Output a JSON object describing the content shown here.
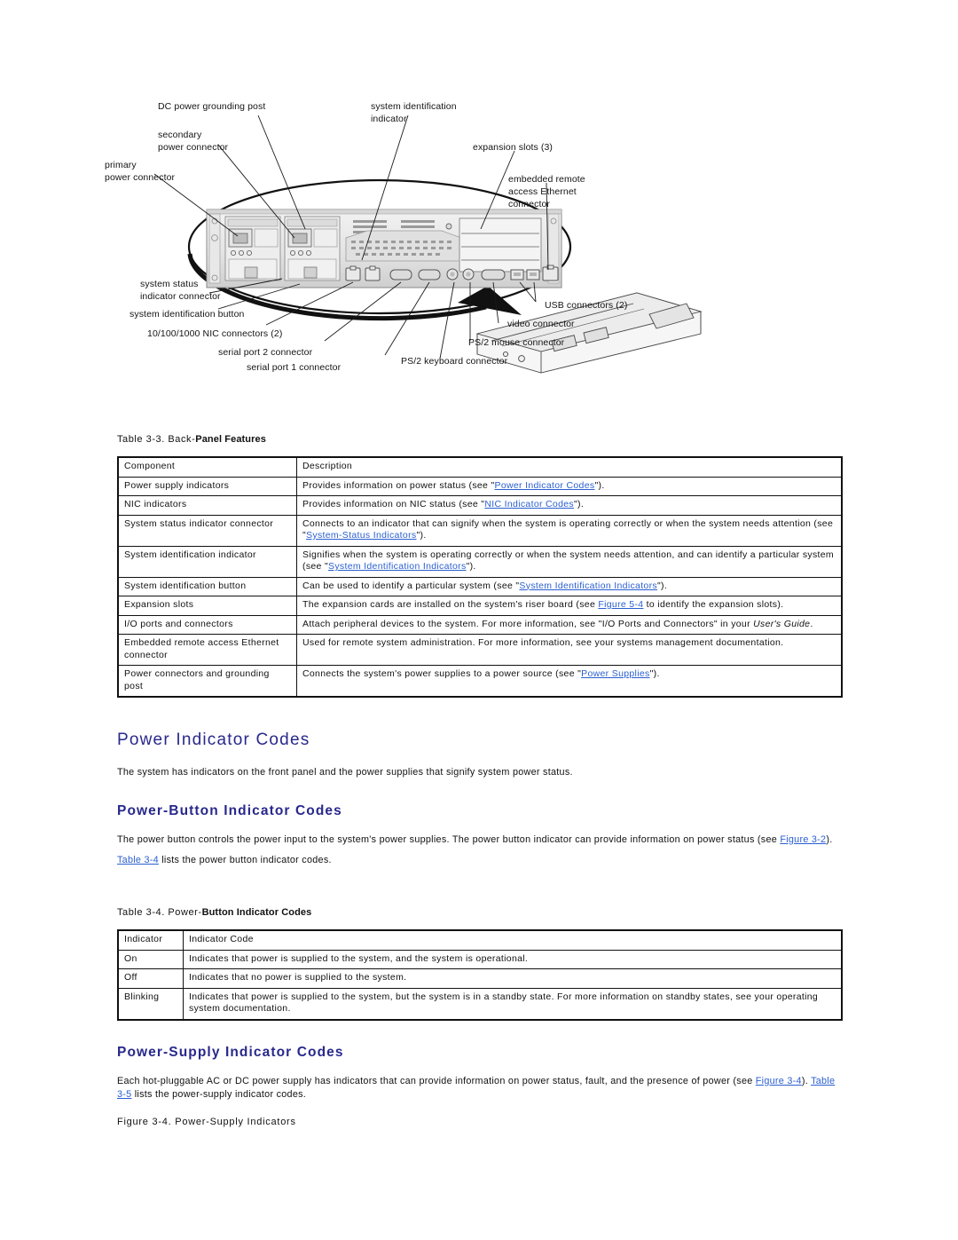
{
  "figure": {
    "name": "back-panel-features-diagram",
    "callouts_top_left": [
      "DC power grounding post",
      "secondary",
      "power connector",
      "primary",
      "power connector"
    ],
    "callout_dc_power_grounding_post": "DC power grounding post",
    "callout_secondary_power_connector_l1": "secondary",
    "callout_secondary_power_connector_l2": "power connector",
    "callout_primary_power_connector_l1": "primary",
    "callout_primary_power_connector_l2": "power connector",
    "callout_system_identification_indicator_l1": "system identification",
    "callout_system_identification_indicator_l2": "indicator",
    "callout_expansion_slots": "expansion slots (3)",
    "callout_embedded_remote_l1": "embedded remote",
    "callout_embedded_remote_l2": "access Ethernet",
    "callout_embedded_remote_l3": "connector",
    "callout_system_status_l1": "system status",
    "callout_system_status_l2": "indicator connector",
    "callout_system_identification_button": "system identification button",
    "callout_nic_connectors": "10/100/1000 NIC connectors (2)",
    "callout_serial_port_2": "serial port 2 connector",
    "callout_serial_port_1": "serial port 1 connector",
    "callout_usb_connectors": "USB connectors (2)",
    "callout_video_connector": "video connector",
    "callout_ps2_mouse": "PS/2 mouse connector",
    "callout_ps2_keyboard": "PS/2 keyboard connector"
  },
  "table33": {
    "caption_plain": "Table 3-3. Back-",
    "caption_bold": "Panel Features",
    "headers": [
      "Component",
      "Description"
    ],
    "rows": [
      {
        "component": "Power supply indicators",
        "desc_pre": "Provides information on power status (see \"",
        "desc_link": "Power Indicator Codes",
        "desc_post": "\")."
      },
      {
        "component": "NIC indicators",
        "desc_pre": "Provides information on NIC status (see \"",
        "desc_link": "NIC Indicator Codes",
        "desc_post": "\")."
      },
      {
        "component": "System status indicator connector",
        "desc_pre": "Connects to an indicator that can signify when the system is operating correctly or when the system needs attention (see \"",
        "desc_link": "System-Status Indicators",
        "desc_post": "\")."
      },
      {
        "component": "System identification indicator",
        "desc_pre": "Signifies when the system is operating correctly or when the system needs attention, and can identify a particular system (see \"",
        "desc_link": "System Identification Indicators",
        "desc_post": "\")."
      },
      {
        "component": "System identification button",
        "desc_pre": "Can be used to identify a particular system (see \"",
        "desc_link": "System Identification Indicators",
        "desc_post": "\")."
      },
      {
        "component": "Expansion slots",
        "desc_pre": "The expansion cards are installed on the system's riser board (see ",
        "desc_link": "Figure 5-4",
        "desc_post": " to identify the expansion slots)."
      },
      {
        "component": "I/O ports and connectors",
        "desc_pre": "Attach peripheral devices to the system. For more information, see \"I/O Ports and Connectors\" in your ",
        "desc_italic": "User's Guide",
        "desc_post": "."
      },
      {
        "component": "Embedded remote access Ethernet connector",
        "desc_pre": "Used for remote system administration. For more information, see your systems management documentation.",
        "desc_link": "",
        "desc_post": ""
      },
      {
        "component": "Power connectors and grounding post",
        "desc_pre": "Connects the system's power supplies to a power source (see \"",
        "desc_link": "Power Supplies",
        "desc_post": "\")."
      }
    ]
  },
  "section_power_indicator_codes": {
    "heading": "Power Indicator Codes",
    "intro": "The system has indicators on the front panel and the power supplies that signify system power status."
  },
  "section_power_button": {
    "heading": "Power-Button Indicator Codes",
    "para1_pre": "The power button controls the power input to the system's power supplies. The power button indicator can provide information on power status (see ",
    "para1_link": "Figure 3-2",
    "para1_post": ").",
    "para2_link": "Table 3-4",
    "para2_post": " lists the power button indicator codes."
  },
  "table34": {
    "caption_plain": "Table 3-4. Power-",
    "caption_bold": "Button Indicator Codes",
    "headers": [
      "Indicator",
      "Indicator Code"
    ],
    "rows": [
      {
        "indicator": "On",
        "code": "Indicates that power is supplied to the system, and the system is operational."
      },
      {
        "indicator": "Off",
        "code": "Indicates that no power is supplied to the system."
      },
      {
        "indicator": "Blinking",
        "code": "Indicates that power is supplied to the system, but the system is in a standby state. For more information on standby states, see your operating system documentation."
      }
    ]
  },
  "section_power_supply": {
    "heading": "Power-Supply Indicator Codes",
    "para_pre": "Each hot-pluggable AC or DC power supply has indicators that can provide information on power status, fault, and the presence of power (see ",
    "para_link1": "Figure 3-4",
    "para_mid": "). ",
    "para_link2": "Table 3-5",
    "para_post": " lists the power-supply indicator codes.",
    "figure_caption": "Figure 3-4. Power-Supply Indicators"
  }
}
